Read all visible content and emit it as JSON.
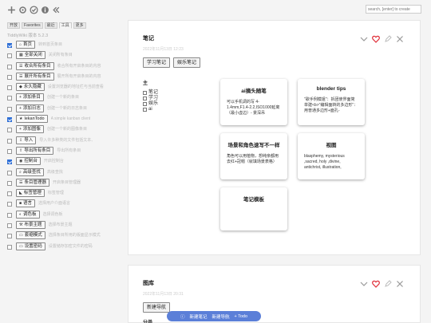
{
  "sidebar": {
    "tabs": [
      "开放",
      "Favorites",
      "最近",
      "工具",
      "更多"
    ],
    "version": "TiddlyWiki 版本 5.2.3",
    "items": [
      {
        "checked": true,
        "icon": "home-icon",
        "label": "首页",
        "desc": "转到首页条目"
      },
      {
        "checked": false,
        "icon": "grid-icon",
        "label": "全部关闭",
        "desc": "关闭所有条目"
      },
      {
        "checked": false,
        "icon": "fold-icon",
        "label": "收合所有条目",
        "desc": "收合所有开启条目的内容"
      },
      {
        "checked": false,
        "icon": "unfold-icon",
        "label": "展开所有条目",
        "desc": "展开所有开启条目的内容"
      },
      {
        "checked": false,
        "icon": "bell-icon",
        "label": "永久隐藏",
        "desc": "设置浏览器的地址栏与当前查看的目前开启条目"
      },
      {
        "checked": false,
        "icon": "plus-icon",
        "label": "添加条目",
        "desc": "创建一个新的条目"
      },
      {
        "checked": false,
        "icon": "plus-icon",
        "label": "添加日志",
        "desc": "创建一个新的日志条目"
      },
      {
        "checked": true,
        "icon": "star-icon",
        "label": "lekanTodo",
        "desc": "A simple kanban client"
      },
      {
        "checked": false,
        "icon": "plus-icon",
        "label": "添加图像",
        "desc": "创建一个新的图像条目"
      },
      {
        "checked": false,
        "icon": "import-icon",
        "label": "导入",
        "desc": "导入许多种类的文件包括文本、图像、TiddlyWiki 或 JSON"
      },
      {
        "checked": false,
        "icon": "export-icon",
        "label": "导出所有条目",
        "desc": "导出所有条目"
      },
      {
        "checked": true,
        "icon": "console-icon",
        "label": "控制台",
        "desc": "开启控制台"
      },
      {
        "checked": false,
        "icon": "search-icon",
        "label": "高级查找",
        "desc": "高级查找"
      },
      {
        "checked": false,
        "icon": "manager-icon",
        "label": "条目管理器",
        "desc": "开启条目管理器"
      },
      {
        "checked": false,
        "icon": "tag-icon",
        "label": "标签管理",
        "desc": "标签管理"
      },
      {
        "checked": false,
        "icon": "flag-icon",
        "label": "语言",
        "desc": "选择用户介面语言"
      },
      {
        "checked": false,
        "icon": "palette-icon",
        "label": "调色板",
        "desc": "选择调色板"
      },
      {
        "checked": false,
        "icon": "theme-icon",
        "label": "布景主题",
        "desc": "选择布景主题"
      },
      {
        "checked": false,
        "icon": "layout-icon",
        "label": "套缩模式",
        "desc": "选择条目所用的版面显示模式"
      },
      {
        "checked": false,
        "icon": "monitor-icon",
        "label": "设置密码",
        "desc": "设置储存加密文件的密码"
      }
    ]
  },
  "search": {
    "placeholder": "search, [enter] to create"
  },
  "tiddler1": {
    "title": "笔记",
    "subtitle": "2022年11月13日 12:23",
    "buttons": [
      "学习笔记",
      "娱乐笔记"
    ],
    "taglist": {
      "heading": "主",
      "items": [
        "笔记",
        "学习",
        "娱乐",
        "ai"
      ]
    },
    "cards": [
      {
        "title": "ai摘头随笔",
        "body": "可以手机调的写 4-1.4mm,F1.4-2.2,ISO1000延离（最小虚边）- 景深吊"
      },
      {
        "title": "blender tips",
        "body": "\"歌手例模姐\"：拆团使界面简单建<b>\"编辑面转的多边形\"：用普通多边形+面孔-"
      },
      {
        "title": "场景和角色速写不一样",
        "body": "角色可以用植物，想纯亲都用去红+冠帽（就填场景表格）"
      },
      {
        "title": "视图",
        "body": "blasphemy, mysterious ,sacred, holy ,divine, antichrist, illustration,"
      },
      {
        "title": "笔记模板",
        "body": ""
      }
    ]
  },
  "tiddler2": {
    "title": "图库",
    "subtitle": "2022年11月13日 20:31",
    "button": "新建导航",
    "extra": "分类"
  },
  "floatbar": {
    "items": [
      "新建笔记",
      "新建导航",
      "+ Todo"
    ]
  }
}
